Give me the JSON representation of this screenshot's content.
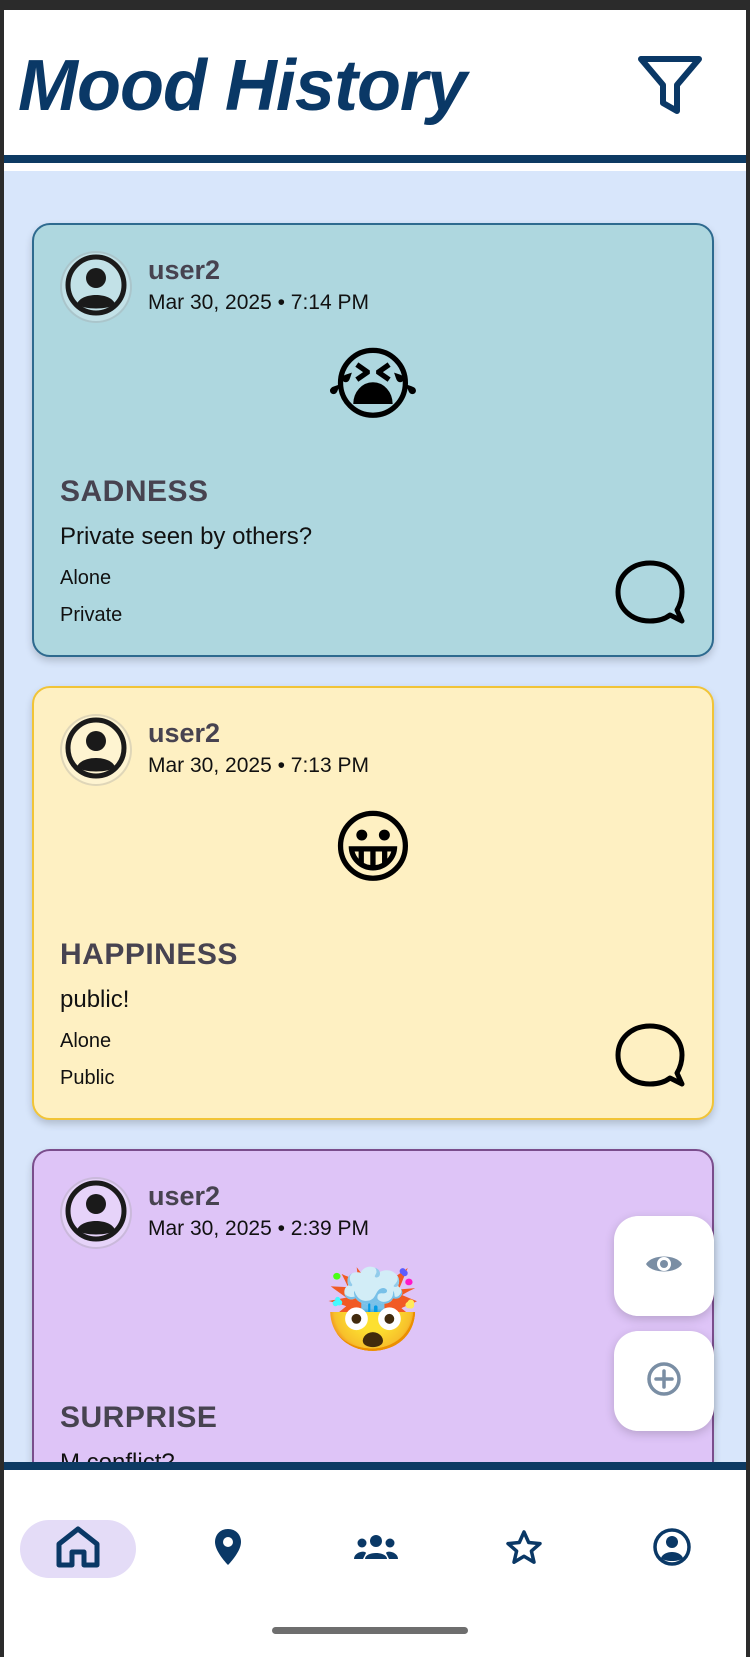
{
  "header": {
    "title": "Mood History",
    "filter_icon": "filter-icon"
  },
  "colors": {
    "brand_navy": "#0a3866",
    "feed_background": "#d8e6fb",
    "sadness_card": "#aed7df",
    "happiness_card": "#fef0c2",
    "surprise_card": "#dec4f7"
  },
  "posts": [
    {
      "username": "user2",
      "timestamp": "Mar 30, 2025 • 7:14 PM",
      "emoji": "😭",
      "emotion": "SADNESS",
      "note": "Private seen by others?",
      "social": "Alone",
      "privacy": "Private"
    },
    {
      "username": "user2",
      "timestamp": "Mar 30, 2025 • 7:13 PM",
      "emoji": "😀",
      "emotion": "HAPPINESS",
      "note": "public!",
      "social": "Alone",
      "privacy": "Public"
    },
    {
      "username": "user2",
      "timestamp": "Mar 30, 2025 • 2:39 PM",
      "emoji": "🤯",
      "emotion": "SURPRISE",
      "note": "M conflict?"
    }
  ],
  "fabs": {
    "view_icon": "eye-icon",
    "add_icon": "plus-circle-icon"
  },
  "bottom_nav": {
    "active": "home",
    "items": [
      "home-icon",
      "map-pin-icon",
      "people-icon",
      "star-icon",
      "account-circle-icon"
    ]
  }
}
